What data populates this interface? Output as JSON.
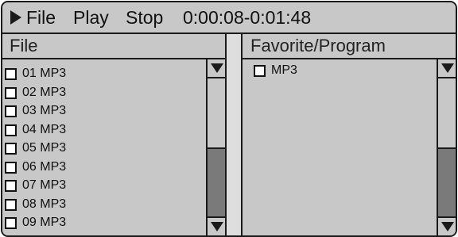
{
  "menubar": {
    "play_icon": "play-triangle-icon",
    "file_label": "File",
    "play_label": "Play",
    "stop_label": "Stop",
    "time_readout": "0:00:08-0:01:48"
  },
  "left_pane": {
    "header": "File",
    "items": [
      {
        "label": "01 MP3"
      },
      {
        "label": "02 MP3"
      },
      {
        "label": "03 MP3"
      },
      {
        "label": "04 MP3"
      },
      {
        "label": "05 MP3"
      },
      {
        "label": "06 MP3"
      },
      {
        "label": "07 MP3"
      },
      {
        "label": "08 MP3"
      },
      {
        "label": "09 MP3"
      }
    ],
    "scrollbar": {
      "up_icon": "scroll-down-arrow-icon",
      "down_icon": "scroll-down-arrow-icon",
      "thumb_start": 0.5,
      "thumb_end": 1.0
    }
  },
  "right_pane": {
    "header": "Favorite/Program",
    "items": [
      {
        "label": "MP3"
      }
    ],
    "scrollbar": {
      "up_icon": "scroll-down-arrow-icon",
      "down_icon": "scroll-down-arrow-icon",
      "thumb_start": 0.5,
      "thumb_end": 1.0
    }
  },
  "colors": {
    "panel": "#c8c8c8",
    "divider": "#dedede",
    "thumb": "#7a7a7a",
    "border": "#1a1a1a",
    "text": "#111111"
  }
}
